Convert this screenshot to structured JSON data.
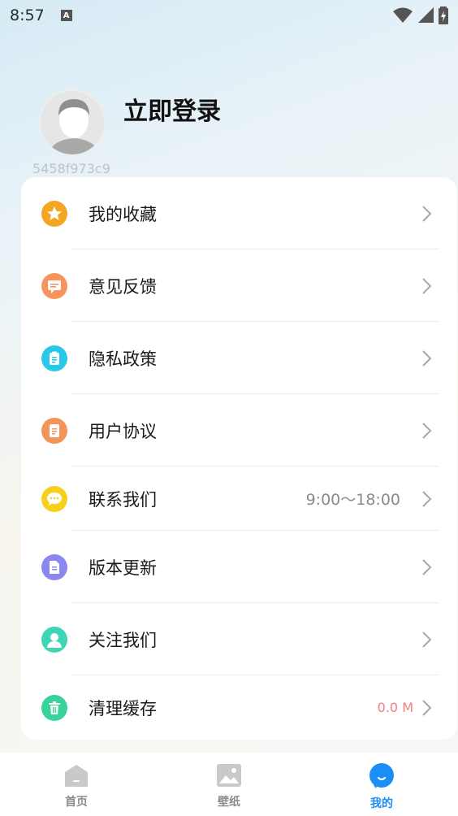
{
  "statusbar": {
    "time": "8:57"
  },
  "profile": {
    "login_text": "立即登录",
    "user_id": "5458f973c9"
  },
  "menu": [
    {
      "label": "我的收藏",
      "icon": "star-icon",
      "color": "#f5a524",
      "value": ""
    },
    {
      "label": "意见反馈",
      "icon": "feedback-icon",
      "color": "#f7935c",
      "value": ""
    },
    {
      "label": "隐私政策",
      "icon": "clipboard-icon",
      "color": "#27c8e8",
      "value": ""
    },
    {
      "label": "用户协议",
      "icon": "document-icon",
      "color": "#f4935a",
      "value": ""
    },
    {
      "label": "联系我们",
      "icon": "chat-icon",
      "color": "#f7cf1d",
      "value": "9:00～18:00"
    },
    {
      "label": "版本更新",
      "icon": "file-icon",
      "color": "#8b86f0",
      "value": ""
    },
    {
      "label": "关注我们",
      "icon": "user-icon",
      "color": "#3fd6b7",
      "value": ""
    },
    {
      "label": "清理缓存",
      "icon": "trash-icon",
      "color": "#38d39b",
      "value": "0.0 M"
    }
  ],
  "tabs": [
    {
      "label": "首页",
      "icon": "home-icon"
    },
    {
      "label": "壁纸",
      "icon": "image-icon"
    },
    {
      "label": "我的",
      "icon": "profile-icon",
      "active": true
    }
  ],
  "colors": {
    "accent": "#1a8ef5",
    "cache_value": "#f07f7f"
  }
}
